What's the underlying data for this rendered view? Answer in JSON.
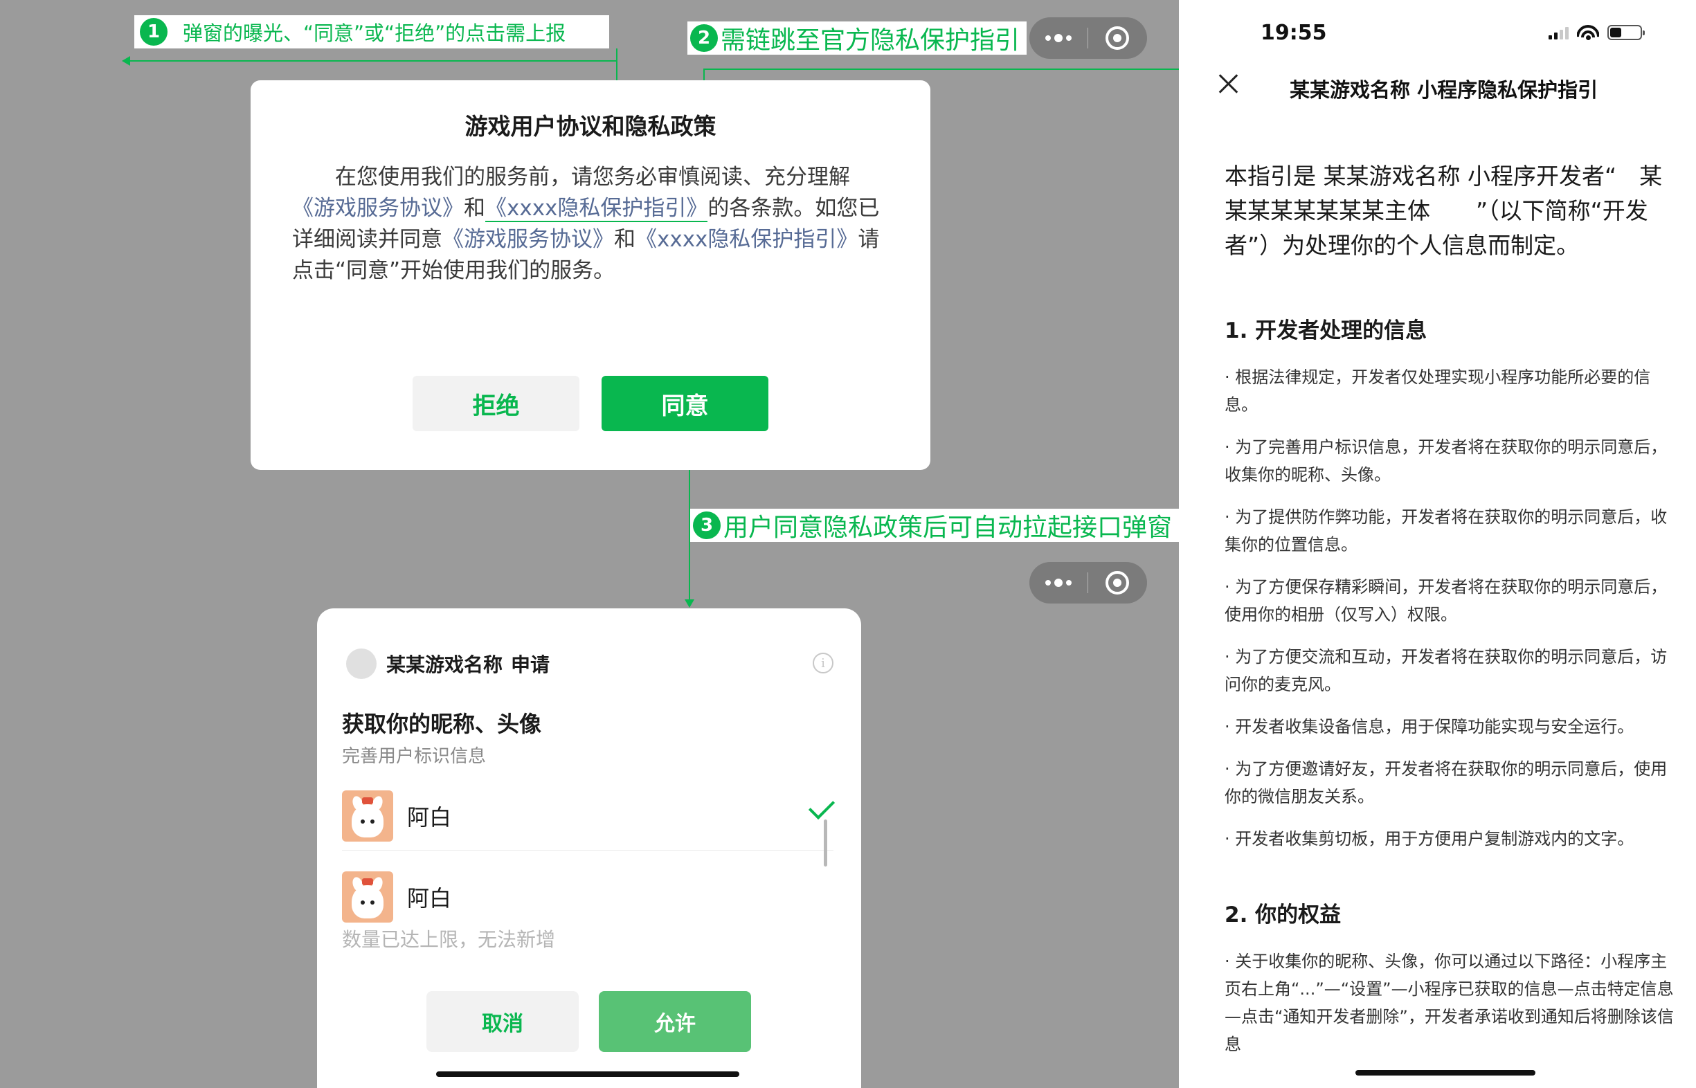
{
  "annotations": {
    "a1": {
      "num": "1",
      "text": "弹窗的曝光、“同意”或“拒绝”的点击需上报"
    },
    "a2": {
      "num": "2",
      "text": "需链跳至官方隐私保护指引"
    },
    "a3": {
      "num": "3",
      "text": "用户同意隐私政策后可自动拉起接口弹窗"
    }
  },
  "colors": {
    "accent": "#09b74f",
    "link": "#576b95",
    "background": "#9b9b9b"
  },
  "capsule": {
    "more_icon": "more-dots-icon",
    "close_icon": "close-circle-icon"
  },
  "consent_dialog": {
    "title": "游戏用户协议和隐私政策",
    "body": {
      "p1": "在您使用我们的服务前，请您务必审慎阅读、充分理解",
      "link_service": "《游戏服务协议》",
      "and": "和",
      "link_privacy": "《xxxx隐私保护指引》",
      "p2": "的各条款。如您已详细阅读并同意",
      "p3": "请点击“同意”开始使用我们的服务。"
    },
    "reject_label": "拒绝",
    "agree_label": "同意"
  },
  "auth_popup": {
    "app_name": "某某游戏名称",
    "apply": "申请",
    "info_icon": "info-icon",
    "ask": "获取你的昵称、头像",
    "purpose": "完善用户标识信息",
    "nicknames": [
      "阿白",
      "阿白"
    ],
    "limit_note": "数量已达上限，无法新增",
    "cancel_label": "取消",
    "allow_label": "允许"
  },
  "guide_page": {
    "status": {
      "time": "19:55"
    },
    "title": "某某游戏名称 小程序隐私保护指引",
    "intro": "本指引是 某某游戏名称 小程序开发者“　某某某某某某某某主体　　”（以下简称“开发者”）为处理你的个人信息而制定。",
    "section1": {
      "heading": "1. 开发者处理的信息",
      "items": [
        "· 根据法律规定，开发者仅处理实现小程序功能所必要的信息。",
        "· 为了完善用户标识信息，开发者将在获取你的明示同意后，收集你的昵称、头像。",
        "· 为了提供防作弊功能，开发者将在获取你的明示同意后，收集你的位置信息。",
        "· 为了方便保存精彩瞬间，开发者将在获取你的明示同意后，使用你的相册（仅写入）权限。",
        "· 为了方便交流和互动，开发者将在获取你的明示同意后，访问你的麦克风。",
        "· 开发者收集设备信息，用于保障功能实现与安全运行。",
        "· 为了方便邀请好友，开发者将在获取你的明示同意后，使用你的微信朋友关系。",
        "· 开发者收集剪切板，用于方便用户复制游戏内的文字。"
      ]
    },
    "section2": {
      "heading": "2. 你的权益",
      "items": [
        "· 关于收集你的昵称、头像，你可以通过以下路径：小程序主页右上角“...”—“设置”—小程序已获取的信息—点击特定信息—点击“通知开发者删除”，开发者承诺收到通知后将删除该信息"
      ]
    }
  }
}
